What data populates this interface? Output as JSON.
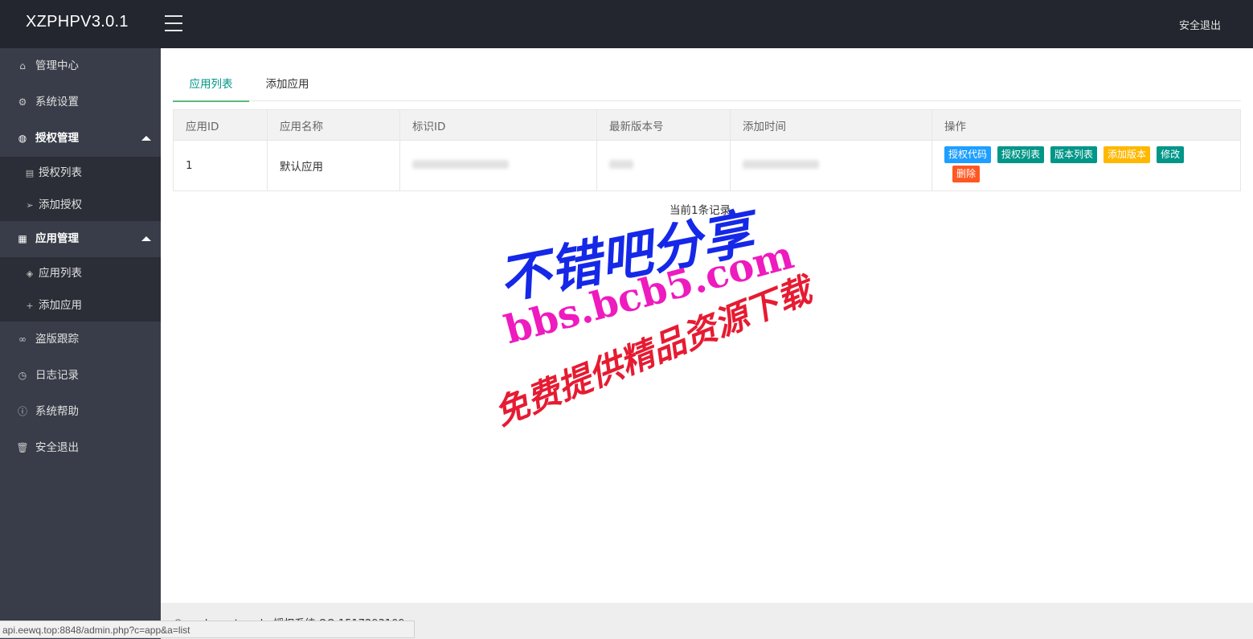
{
  "header": {
    "logo": "XZPHPV3.0.1",
    "logout": "安全退出"
  },
  "sidebar": {
    "items": [
      {
        "label": "管理中心",
        "icon": "home-icon"
      },
      {
        "label": "系统设置",
        "icon": "gear-icon"
      },
      {
        "label": "授权管理",
        "icon": "globe-icon",
        "expanded": true,
        "children": [
          {
            "label": "授权列表",
            "icon": "document-icon"
          },
          {
            "label": "添加授权",
            "icon": "send-icon"
          }
        ]
      },
      {
        "label": "应用管理",
        "icon": "apps-icon",
        "expanded": true,
        "children": [
          {
            "label": "应用列表",
            "icon": "layers-icon"
          },
          {
            "label": "添加应用",
            "icon": "plus-icon"
          }
        ]
      },
      {
        "label": "盗版跟踪",
        "icon": "link-icon"
      },
      {
        "label": "日志记录",
        "icon": "clock-icon"
      },
      {
        "label": "系统帮助",
        "icon": "info-icon"
      },
      {
        "label": "安全退出",
        "icon": "trash-icon"
      }
    ]
  },
  "tabs": [
    "应用列表",
    "添加应用"
  ],
  "table": {
    "headers": [
      "应用ID",
      "应用名称",
      "标识ID",
      "最新版本号",
      "添加时间",
      "操作"
    ],
    "rows": [
      {
        "id": "1",
        "name": "默认应用"
      }
    ],
    "actions": [
      {
        "label": "授权代码",
        "color": "#1e9fff"
      },
      {
        "label": "授权列表",
        "color": "#009688"
      },
      {
        "label": "版本列表",
        "color": "#009688"
      },
      {
        "label": "添加版本",
        "color": "#ffb800"
      },
      {
        "label": "修改",
        "color": "#009688"
      },
      {
        "label": "删除",
        "color": "#ff5722"
      }
    ]
  },
  "record_count": "当前1条记录",
  "watermark": {
    "line1": "不错吧分享",
    "line2": "bbs.bcb5.com",
    "line3": "免费提供精品资源下载"
  },
  "footer": {
    "text": "© xzphp.net xzphp授权系统 QQ 1517293109"
  },
  "statusbar": {
    "url": "api.eewq.top:8848/admin.php?c=app&a=list"
  }
}
